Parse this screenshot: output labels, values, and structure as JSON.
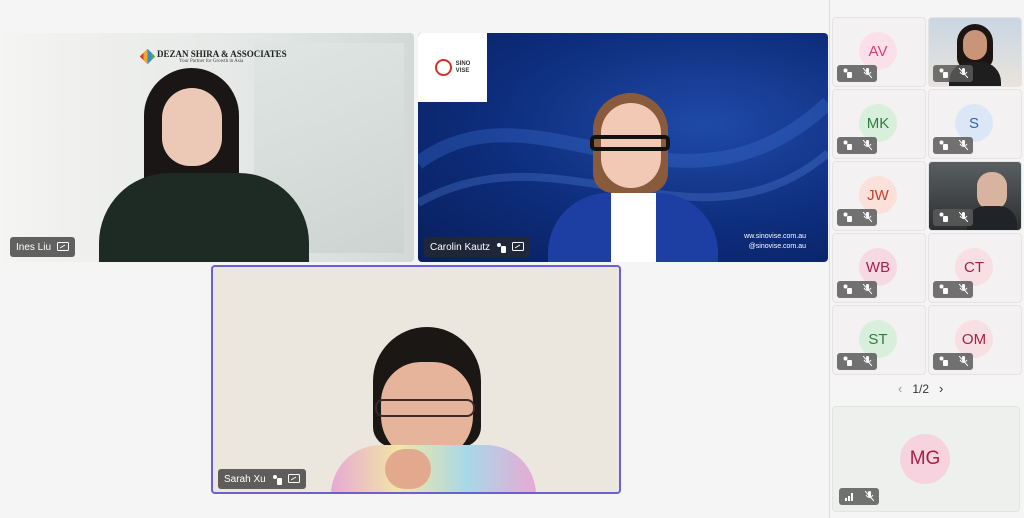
{
  "tiles": {
    "ines": {
      "name": "Ines Liu",
      "logo_title": "DEZAN SHIRA & ASSOCIATES",
      "logo_sub": "Your Partner for Growth in Asia"
    },
    "carolin": {
      "name": "Carolin Kautz",
      "logo_line1": "SINO",
      "logo_line2": "VISE",
      "web1": "ww.sinovise.com.au",
      "web2": "@sinovise.com.au"
    },
    "sarah": {
      "name": "Sarah Xu"
    }
  },
  "sidebar": {
    "participants": [
      {
        "initials": "AV",
        "color": "#d7407a",
        "bg": "#fbe0ea"
      },
      {
        "initials": "",
        "photo": true
      },
      {
        "initials": "MK",
        "color": "#2f7d3a",
        "bg": "#d8efdb"
      },
      {
        "initials": "S",
        "color": "#3364a8",
        "bg": "#dbe7f6"
      },
      {
        "initials": "JW",
        "color": "#c2412d",
        "bg": "#fbe1d9"
      },
      {
        "initials": "",
        "photo": true
      },
      {
        "initials": "WB",
        "color": "#a32248",
        "bg": "#f6d9e2"
      },
      {
        "initials": "CT",
        "color": "#a32248",
        "bg": "#f7dfe4"
      },
      {
        "initials": "ST",
        "color": "#2f7d3a",
        "bg": "#d8efdb"
      },
      {
        "initials": "OM",
        "color": "#a32248",
        "bg": "#f7dfe4"
      }
    ],
    "pager": "1/2",
    "featured": {
      "initials": "MG",
      "color": "#a32248",
      "bg": "#f6d3df"
    }
  }
}
